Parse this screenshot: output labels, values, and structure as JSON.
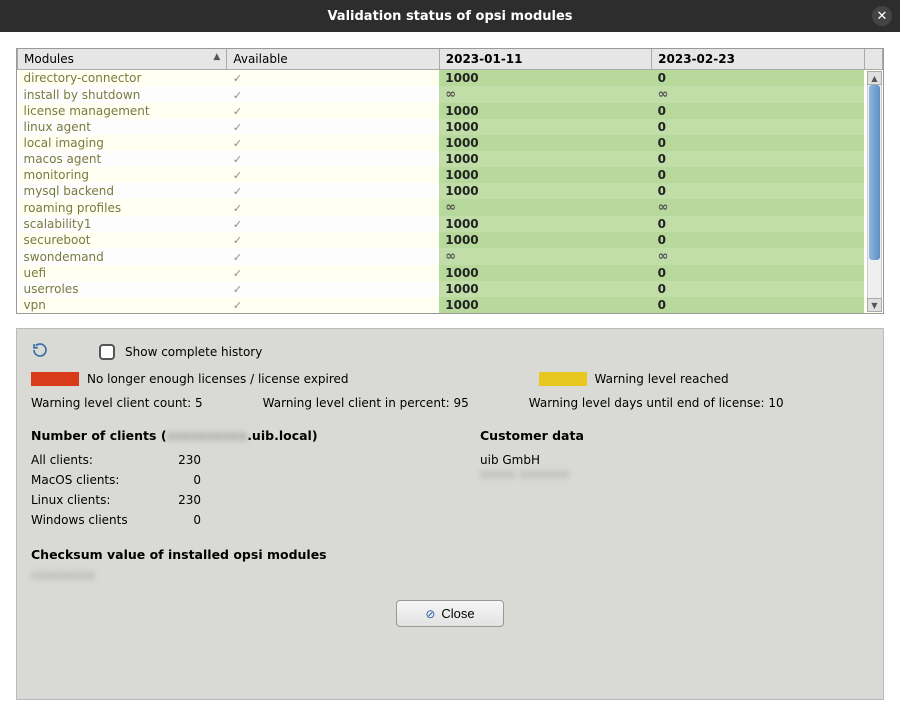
{
  "window": {
    "title": "Validation status of opsi modules"
  },
  "table": {
    "columns": {
      "modules": "Modules",
      "available": "Available",
      "date1": "2023-01-11",
      "date2": "2023-02-23"
    },
    "rows": [
      {
        "name": "directory-connector",
        "avail": "check",
        "d1": "1000",
        "d2": "0"
      },
      {
        "name": "install by shutdown",
        "avail": "check",
        "d1": "inf",
        "d2": "inf"
      },
      {
        "name": "license management",
        "avail": "check",
        "d1": "1000",
        "d2": "0"
      },
      {
        "name": "linux agent",
        "avail": "check",
        "d1": "1000",
        "d2": "0"
      },
      {
        "name": "local imaging",
        "avail": "check",
        "d1": "1000",
        "d2": "0"
      },
      {
        "name": "macos agent",
        "avail": "check",
        "d1": "1000",
        "d2": "0"
      },
      {
        "name": "monitoring",
        "avail": "check",
        "d1": "1000",
        "d2": "0"
      },
      {
        "name": "mysql backend",
        "avail": "check",
        "d1": "1000",
        "d2": "0"
      },
      {
        "name": "roaming profiles",
        "avail": "check",
        "d1": "inf",
        "d2": "inf"
      },
      {
        "name": "scalability1",
        "avail": "check",
        "d1": "1000",
        "d2": "0"
      },
      {
        "name": "secureboot",
        "avail": "check",
        "d1": "1000",
        "d2": "0"
      },
      {
        "name": "swondemand",
        "avail": "check",
        "d1": "inf",
        "d2": "inf"
      },
      {
        "name": "uefi",
        "avail": "check",
        "d1": "1000",
        "d2": "0"
      },
      {
        "name": "userroles",
        "avail": "check",
        "d1": "1000",
        "d2": "0"
      },
      {
        "name": "vpn",
        "avail": "check",
        "d1": "1000",
        "d2": "0"
      }
    ]
  },
  "controls": {
    "show_history": "Show complete history"
  },
  "legend": {
    "red": "No longer enough licenses / license expired",
    "yellow": "Warning level reached"
  },
  "warnings": {
    "client_count_label": "Warning level client count:",
    "client_count": "5",
    "client_percent_label": "Warning level client in percent:",
    "client_percent": "95",
    "days_label": "Warning level days until end of license:",
    "days": "10"
  },
  "clients": {
    "heading_prefix": "Number of clients (",
    "heading_host_hidden": "xxxxxxxxxx",
    "heading_suffix": ".uib.local)",
    "rows": {
      "all_label": "All clients:",
      "all": "230",
      "macos_label": "MacOS clients:",
      "macos": "0",
      "linux_label": "Linux clients:",
      "linux": "230",
      "windows_label": "Windows clients",
      "windows": "0"
    }
  },
  "customer": {
    "heading": "Customer data",
    "name": "uib GmbH",
    "addr_hidden": "xxxxx xxxxxxx"
  },
  "checksum": {
    "heading": "Checksum value of installed opsi modules",
    "value_hidden": "xxxxxxxxx"
  },
  "buttons": {
    "close": "Close"
  }
}
